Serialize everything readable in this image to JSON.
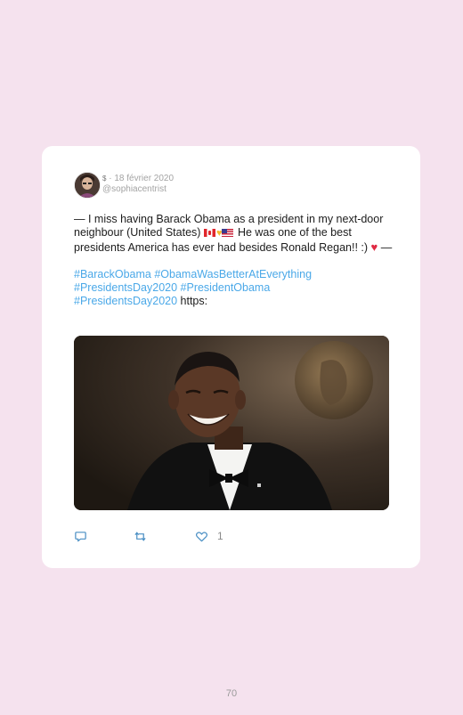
{
  "tweet": {
    "date_meta": "· 18 février 2020",
    "dollar_glyph": "$",
    "handle": "@sophiacentrist",
    "text_part1": "— I miss having Barack Obama as a president in my next-door neighbour (United States)",
    "text_part2": "He was one of the best presidents America has ever had besides Ronald Regan!! :)",
    "text_part3": "—",
    "hashtag_line1a": "#BarackObama",
    "hashtag_line1b": "#ObamaWasBetterAtEverything",
    "hashtag_line2a": "#PresidentsDay2020",
    "hashtag_line2b": "#PresidentObama",
    "hashtag_line3": "#PresidentsDay2020",
    "trailing_text": "https:",
    "like_count": "1"
  },
  "icons": {
    "reply": "reply-icon",
    "retweet": "retweet-icon",
    "like": "heart-icon"
  },
  "colors": {
    "background": "#f5e2ee",
    "card": "#ffffff",
    "hashtag": "#4aa8e8"
  },
  "page": {
    "number": "70"
  }
}
